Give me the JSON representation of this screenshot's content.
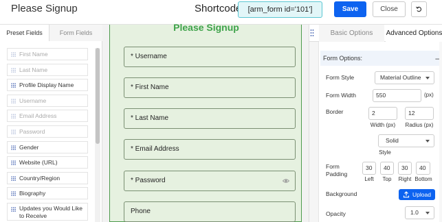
{
  "header": {
    "title": "Please Signup",
    "shortcode_label": "Shortcode:",
    "shortcode_value": "[arm_form id='101']",
    "save_label": "Save",
    "close_label": "Close",
    "reset_icon": "undo-icon"
  },
  "left_panel": {
    "tabs": [
      "Preset Fields",
      "Form Fields"
    ],
    "fields": [
      {
        "label": "First Name",
        "active": false
      },
      {
        "label": "Last Name",
        "active": false
      },
      {
        "label": "Profile Display Name",
        "active": true
      },
      {
        "label": "Username",
        "active": false
      },
      {
        "label": "Email Address",
        "active": false
      },
      {
        "label": "Password",
        "active": false
      },
      {
        "label": "Gender",
        "active": true
      },
      {
        "label": "Website (URL)",
        "active": true
      },
      {
        "label": "Country/Region",
        "active": true
      },
      {
        "label": "Biography",
        "active": true
      },
      {
        "label": "Updates you Would Like to Receive",
        "active": true
      }
    ]
  },
  "form": {
    "title": "Please Signup",
    "inputs": [
      "* Username",
      "* First Name",
      "* Last Name",
      "* Email Address",
      "* Password",
      "Phone"
    ]
  },
  "right_panel": {
    "tabs": [
      "Basic Options",
      "Advanced Options"
    ],
    "section_title": "Form Options:",
    "collapse_symbol": "–",
    "form_style_label": "Form Style",
    "form_style_value": "Material Outline",
    "form_width_label": "Form Width",
    "form_width_value": "550",
    "form_width_unit": "(px)",
    "border_label": "Border",
    "border_width_value": "2",
    "border_width_caption": "Width (px)",
    "border_radius_value": "12",
    "border_radius_caption": "Radius (px)",
    "border_style_value": "Solid",
    "border_style_caption": "Style",
    "padding_label": "Form Padding",
    "padding": [
      {
        "value": "30",
        "caption": "Left"
      },
      {
        "value": "40",
        "caption": "Top"
      },
      {
        "value": "30",
        "caption": "Right"
      },
      {
        "value": "40",
        "caption": "Bottom"
      }
    ],
    "background_label": "Background",
    "upload_label": "Upload",
    "opacity_label": "Opacity",
    "opacity_value": "1.0"
  },
  "colors": {
    "primary": "#0d63f0",
    "form_bg": "#e6f1e0",
    "form_title": "#3ea34a",
    "shortcode_bg": "#e2f6f8"
  }
}
